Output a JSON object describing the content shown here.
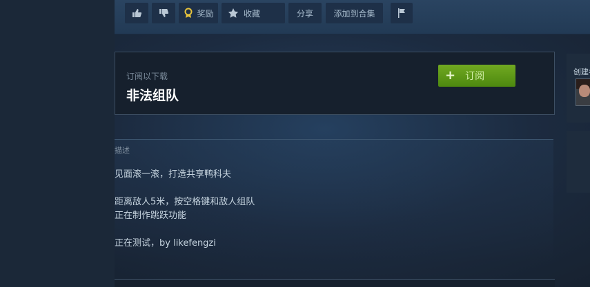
{
  "actions": {
    "thumbs_up_icon": "thumbs-up-icon",
    "thumbs_down_icon": "thumbs-down-icon",
    "award_label": "奖励",
    "favorite_label": "收藏",
    "share_label": "分享",
    "add_collection_label": "添加到合集",
    "flag_icon": "flag-icon"
  },
  "subscribe": {
    "label": "订阅以下载",
    "title": "非法组队",
    "button_label": "订阅",
    "button_color": "#5c9a15"
  },
  "sidebar": {
    "created_label": "创建者"
  },
  "description": {
    "heading": "描述",
    "lines": [
      "见面滚一滚，打造共享鸭科夫",
      "距离敌人5米，按空格键和敌人组队",
      "正在制作跳跃功能",
      "正在测试，by likefengzi"
    ]
  }
}
